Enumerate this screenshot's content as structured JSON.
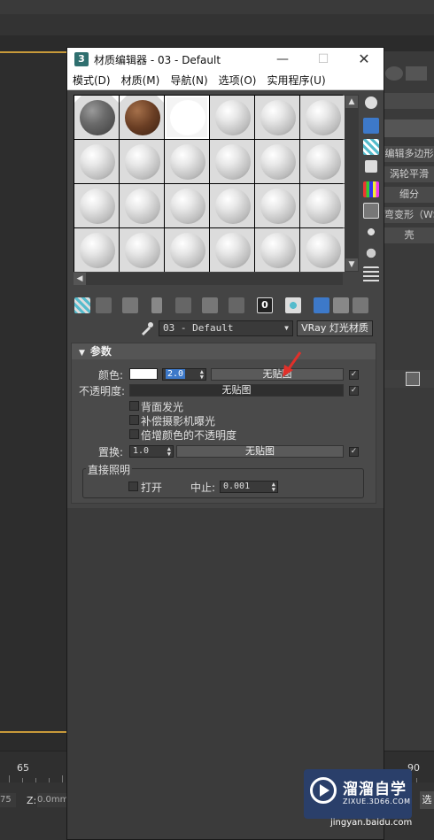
{
  "background": {
    "right_panel_items": [
      "编辑多边形",
      "涡轮平滑",
      "细分",
      "弯变形（WS",
      "壳"
    ],
    "timeline_labels": [
      "65",
      "90"
    ],
    "status_z_label": "Z:",
    "status_z_value": "0.0mm",
    "status_left_value": "75",
    "status_right_text": "选"
  },
  "dialog": {
    "title": "材质编辑器 - 03 - Default",
    "title_icon": "3",
    "menu": [
      "模式(D)",
      "材质(M)",
      "导航(N)",
      "选项(O)",
      "实用程序(U)"
    ],
    "material_name": "03 - Default",
    "material_type": "VRay 灯光材质",
    "scroll_up": "▲",
    "scroll_down": "▼",
    "scroll_left": "◀",
    "bottom_tool_number": "0"
  },
  "params": {
    "rollout_title": "参数",
    "color_label": "颜色:",
    "color_value": "2.0",
    "color_map": "无贴图",
    "opacity_label": "不透明度:",
    "opacity_map": "无贴图",
    "backface_label": "背面发光",
    "compensate_label": "补偿摄影机曝光",
    "multiply_label": "倍增颜色的不透明度",
    "displace_label": "置换:",
    "displace_value": "1.0",
    "displace_map": "无贴图",
    "direct_group": "直接照明",
    "direct_on_label": "打开",
    "cutoff_label": "中止:",
    "cutoff_value": "0.001"
  },
  "watermark": {
    "brand": "溜溜自学",
    "domain": "ZIXUE.3D66.COM",
    "source": "jingyan.baidu.com"
  },
  "colors": {
    "accent_select": "#3d79c9",
    "arrow": "#e0302a",
    "gold": "#c89a3a"
  }
}
